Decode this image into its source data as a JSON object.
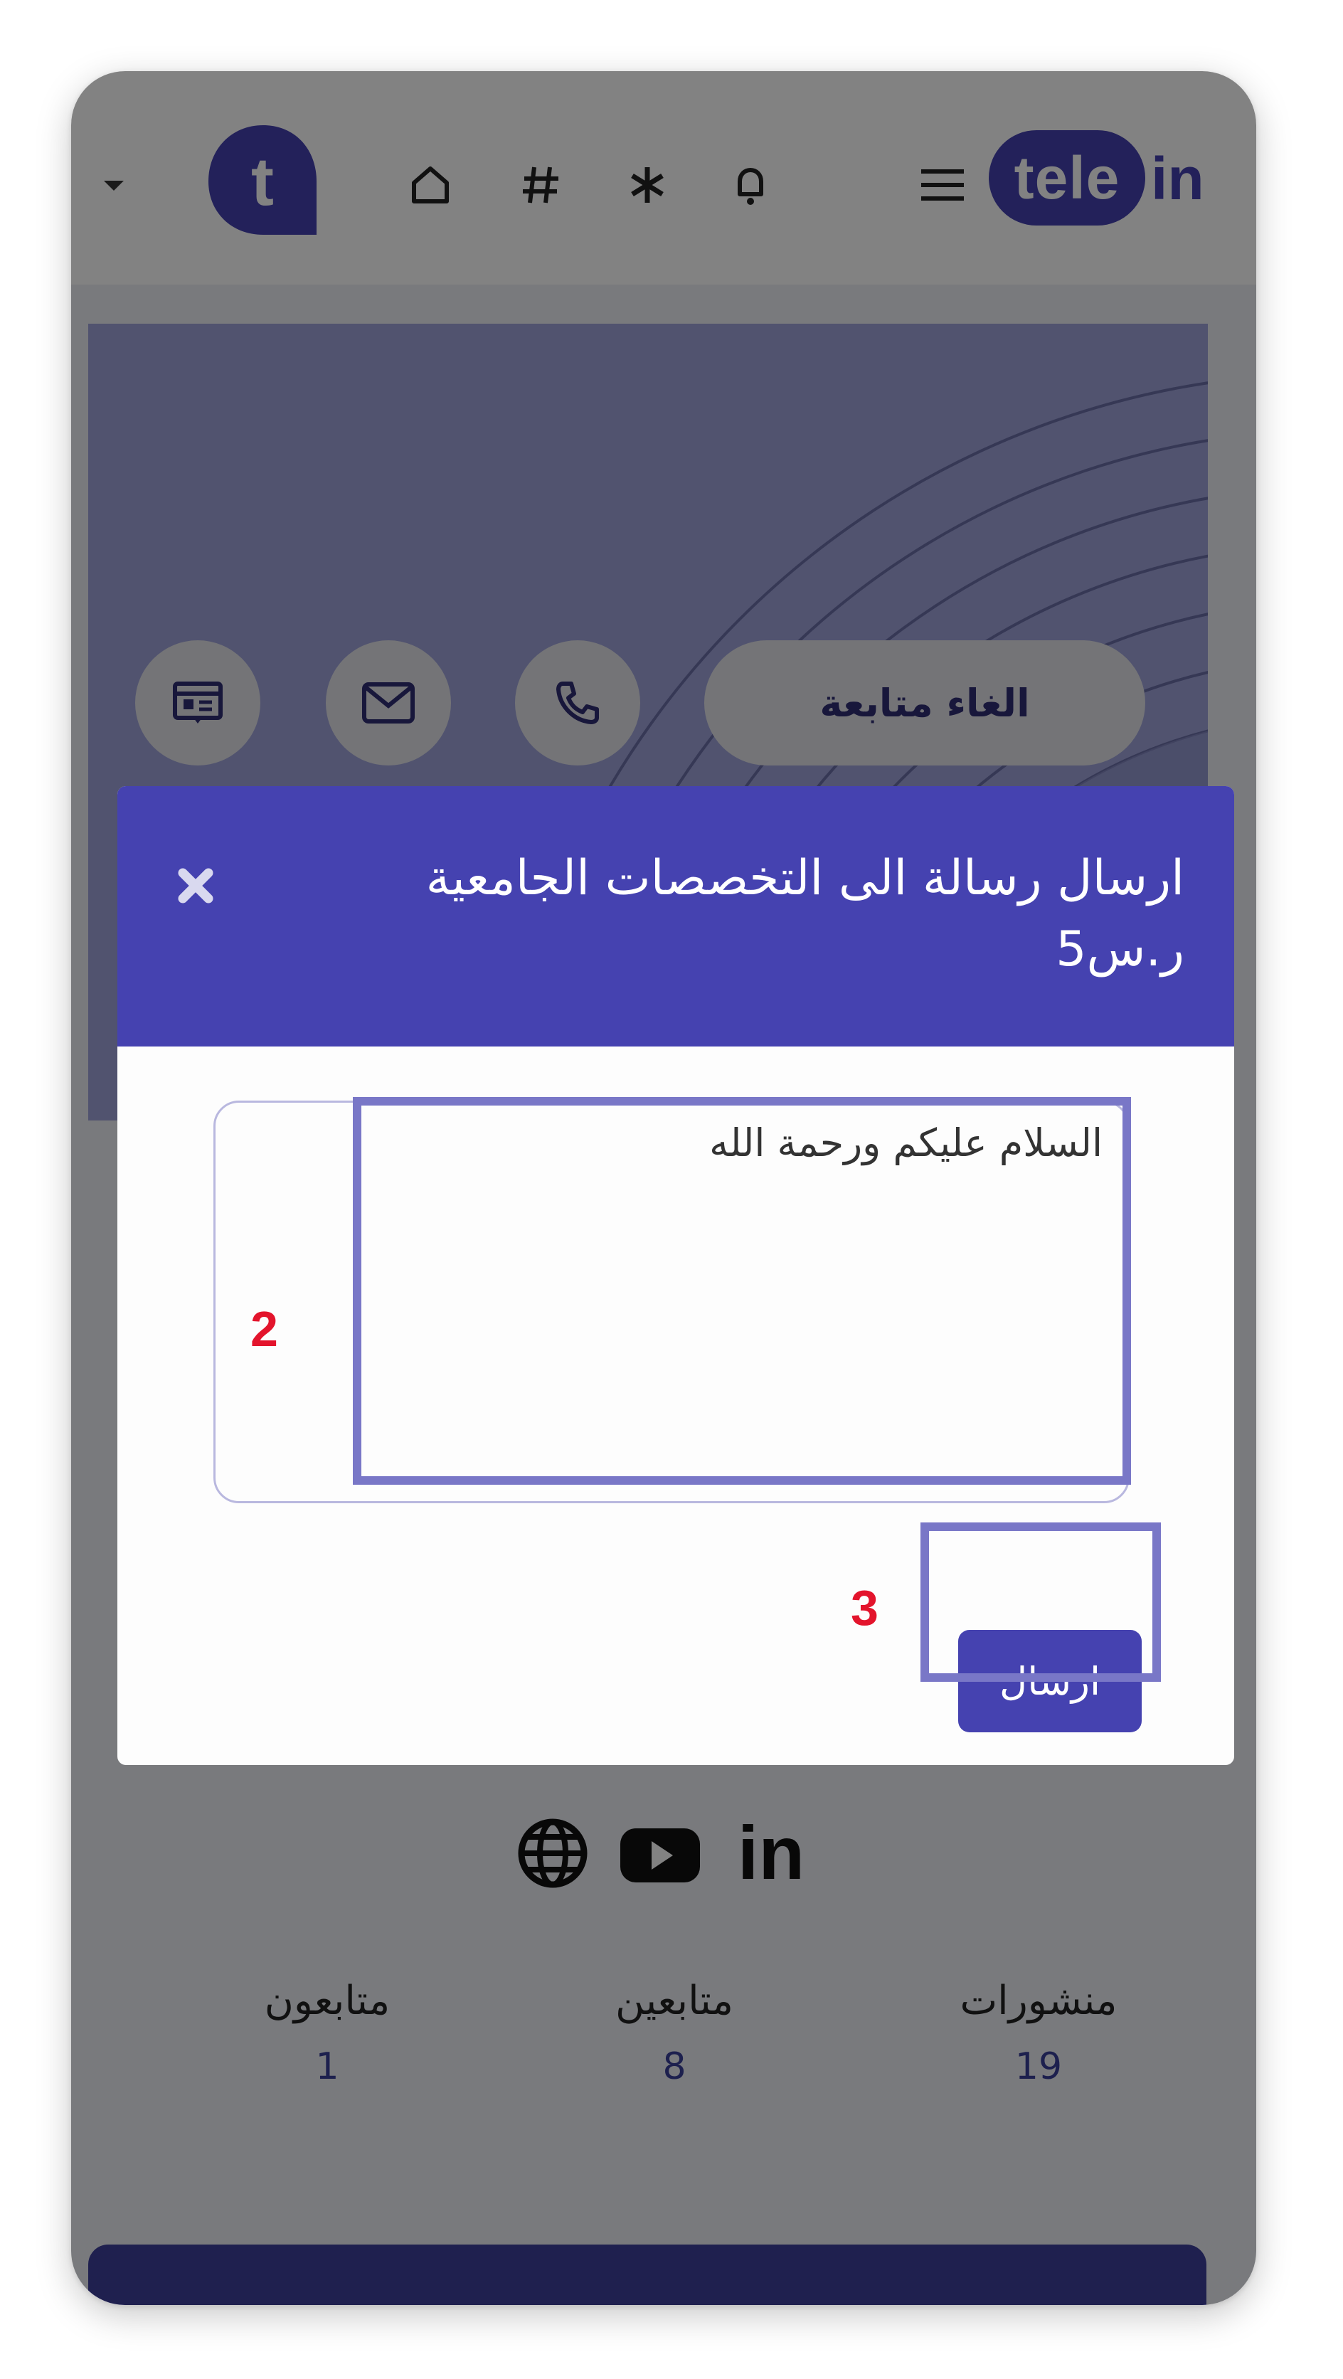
{
  "topbar": {
    "logo": {
      "part1": "tele",
      "part2": "in"
    },
    "avatar_letter": "t",
    "icons": [
      "chevron-down-icon",
      "home-icon",
      "hashtag-icon",
      "asterisk-icon",
      "bell-icon",
      "menu-icon"
    ]
  },
  "profile": {
    "unfollow_label": "الغاء متابعة",
    "action_icons": [
      "id-card-icon",
      "mail-icon",
      "phone-icon"
    ],
    "social_icons": [
      "globe-icon",
      "youtube-icon",
      "linkedin-icon"
    ],
    "stats": [
      {
        "label": "منشورات",
        "value": "19"
      },
      {
        "label": "متابعين",
        "value": "8"
      },
      {
        "label": "متابعون",
        "value": "1"
      }
    ]
  },
  "modal": {
    "title_line1": "ارسال رسالة الى التخصصات الجامعية",
    "title_line2": "ر.س5",
    "message_value": "السلام عليكم ورحمة الله",
    "send_label": "ارسال"
  },
  "annotations": {
    "step_2": "2",
    "step_3": "3"
  },
  "colors": {
    "primary": "#4542b0",
    "highlight": "#7977c7",
    "step_number": "#e3142c"
  }
}
